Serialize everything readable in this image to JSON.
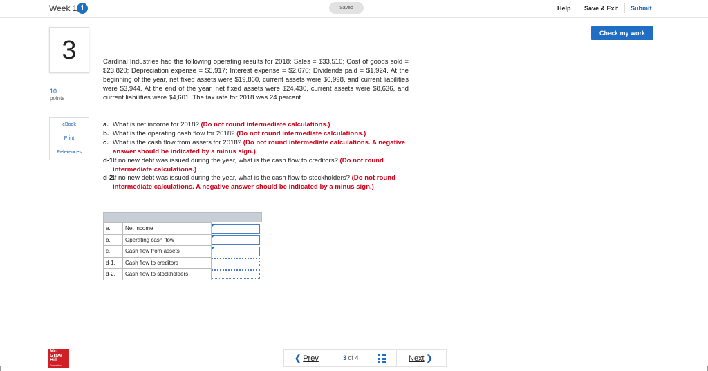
{
  "header": {
    "week": "Week 1",
    "info_icon": "info-icon",
    "saved": "Saved",
    "help": "Help",
    "save_exit": "Save & Exit",
    "submit": "Submit"
  },
  "check_button": "Check my work",
  "question": {
    "number": "3",
    "points_value": "10",
    "points_label": "points",
    "links": [
      "eBook",
      "Print",
      "References"
    ],
    "text": "Cardinal Industries had the following operating results for 2018: Sales = $33,510; Cost of goods sold = $23,820; Depreciation expense = $5,917; Interest expense = $2,670; Dividends paid = $1,924. At the beginning of the year, net fixed assets were $19,860, current assets were $6,998, and current liabilities were $3,944. At the end of the year, net fixed assets were $24,430, current assets were $8,636, and current liabilities were $4,601. The tax rate for 2018 was 24 percent.",
    "parts": [
      {
        "label": "a.",
        "text": "What is net income for 2018? ",
        "note": "(Do not round intermediate calculations.)"
      },
      {
        "label": "b.",
        "text": "What is the operating cash flow for 2018? ",
        "note": "(Do not round intermediate calculations.)"
      },
      {
        "label": "c.",
        "text": "What is the cash flow from assets for 2018? ",
        "note": "(Do not round intermediate calculations. A negative answer should be indicated by a minus sign.)"
      },
      {
        "label": "d-1.",
        "text": "If no new debt was issued during the year, what is the cash flow to creditors? ",
        "note": "(Do not round intermediate calculations.)"
      },
      {
        "label": "d-2.",
        "text": "If no new debt was issued during the year, what is the cash flow to stockholders? ",
        "note": "(Do not round intermediate calculations. A negative answer should be indicated by a minus sign.)"
      }
    ]
  },
  "answers": {
    "rows": [
      {
        "label": "a.",
        "name": "Net income",
        "value": ""
      },
      {
        "label": "b.",
        "name": "Operating cash flow",
        "value": ""
      },
      {
        "label": "c.",
        "name": "Cash flow from assets",
        "value": ""
      },
      {
        "label": "d-1.",
        "name": "Cash flow to creditors",
        "value": ""
      },
      {
        "label": "d-2.",
        "name": "Cash flow to stockholders",
        "value": ""
      }
    ]
  },
  "footer": {
    "logo_lines": [
      "Mc",
      "Graw",
      "Hill"
    ],
    "logo_sub": "Education",
    "prev": "Prev",
    "page_current": "3",
    "page_of": "of 4",
    "next": "Next",
    "grid_icon": "grid-icon"
  }
}
